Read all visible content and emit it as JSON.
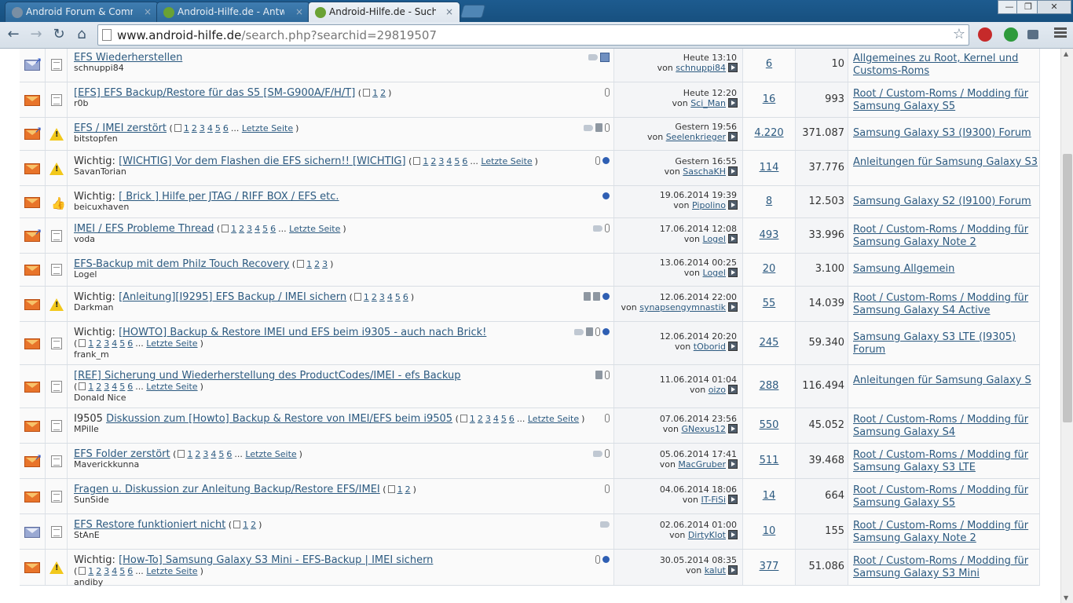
{
  "browser": {
    "tabs": [
      {
        "title": "Android Forum & Comm",
        "active": false
      },
      {
        "title": "Android-Hilfe.de - Antwo",
        "active": false
      },
      {
        "title": "Android-Hilfe.de - Sucher",
        "active": true
      }
    ],
    "close_glyph": "×",
    "url_host": "www.android-hilfe.de",
    "url_path": "/search.php?searchid=29819507",
    "window_controls": {
      "minimize": "—",
      "maximize": "❐",
      "close": "✕"
    }
  },
  "labels": {
    "prefix_important": "Wichtig:",
    "by": "von",
    "last_page": "Letzte Seite",
    "ellipsis": "..."
  },
  "threads": [
    {
      "status": "read-arrow",
      "icon": "doc",
      "prefix": "",
      "title": "EFS Wiederherstellen",
      "pages": [],
      "last_page": false,
      "author": "schnuppi84",
      "tags": [
        "tag",
        "check"
      ],
      "date": "Heute 13:10",
      "last_by": "schnuppi84",
      "replies": "6",
      "views": "10",
      "forum": "Allgemeines zu Root, Kernel und Customs-Roms"
    },
    {
      "status": "unread",
      "icon": "doc",
      "prefix": "",
      "title": "[EFS] EFS Backup/Restore für das S5 [SM-G900A/F/H/T]",
      "pages": [
        "1",
        "2"
      ],
      "last_page": false,
      "author": "r0b",
      "tags": [
        "clip"
      ],
      "date": "Heute 12:20",
      "last_by": "Sci_Man",
      "replies": "16",
      "views": "993",
      "forum": "Root / Custom-Roms / Modding für Samsung Galaxy S5"
    },
    {
      "status": "unread-arrow",
      "icon": "warn",
      "prefix": "",
      "title": "EFS / IMEI zerstört",
      "pages": [
        "1",
        "2",
        "3",
        "4",
        "5",
        "6"
      ],
      "last_page": true,
      "author": "bitstopfen",
      "tags": [
        "tag",
        "trash",
        "clip"
      ],
      "date": "Gestern 19:56",
      "last_by": "Seelenkrieger",
      "replies": "4.220",
      "views": "371.087",
      "forum": "Samsung Galaxy S3 (I9300) Forum"
    },
    {
      "status": "unread",
      "icon": "warn",
      "prefix": "Wichtig:",
      "title": "[WICHTIG] Vor dem Flashen die EFS sichern!! [WICHTIG]",
      "pages": [
        "1",
        "2",
        "3",
        "4",
        "5",
        "6"
      ],
      "last_page": true,
      "author": "SavanTorian",
      "tags": [
        "clip",
        "pin"
      ],
      "date": "Gestern 16:55",
      "last_by": "SaschaKH",
      "replies": "114",
      "views": "37.776",
      "forum": "Anleitungen für Samsung Galaxy S3"
    },
    {
      "status": "unread",
      "icon": "thumb",
      "prefix": "Wichtig:",
      "title": "[ Brick ] Hilfe per JTAG / RIFF BOX / EFS etc.",
      "pages": [],
      "last_page": false,
      "author": "beicuxhaven",
      "tags": [
        "pin"
      ],
      "date": "19.06.2014 19:39",
      "last_by": "Pipolino",
      "replies": "8",
      "views": "12.503",
      "forum": "Samsung Galaxy S2 (I9100) Forum"
    },
    {
      "status": "unread-arrow",
      "icon": "doc",
      "prefix": "",
      "title": "IMEI / EFS Probleme Thread",
      "pages": [
        "1",
        "2",
        "3",
        "4",
        "5",
        "6"
      ],
      "last_page": true,
      "author": "voda",
      "tags": [
        "tag",
        "clip"
      ],
      "date": "17.06.2014 12:08",
      "last_by": "Logel",
      "replies": "493",
      "views": "33.996",
      "forum": "Root / Custom-Roms / Modding für Samsung Galaxy Note 2"
    },
    {
      "status": "unread",
      "icon": "doc",
      "prefix": "",
      "title": "EFS-Backup mit dem Philz Touch Recovery",
      "pages": [
        "1",
        "2",
        "3"
      ],
      "last_page": false,
      "author": "Logel",
      "tags": [],
      "date": "13.06.2014 00:25",
      "last_by": "Logel",
      "replies": "20",
      "views": "3.100",
      "forum": "Samsung Allgemein"
    },
    {
      "status": "unread",
      "icon": "warn",
      "prefix": "Wichtig:",
      "title": "[Anleitung][I9295] EFS Backup / IMEI sichern",
      "pages": [
        "1",
        "2",
        "3",
        "4",
        "5",
        "6"
      ],
      "last_page": false,
      "author": "Darkman",
      "tags": [
        "trash",
        "trash",
        "pin"
      ],
      "date": "12.06.2014 22:00",
      "last_by": "synapsengymnastik",
      "replies": "55",
      "views": "14.039",
      "forum": "Root / Custom-Roms / Modding für Samsung Galaxy S4 Active"
    },
    {
      "status": "unread",
      "icon": "doc",
      "prefix": "Wichtig:",
      "title": "[HOWTO] Backup & Restore IMEI und EFS beim i9305 - auch nach Brick!",
      "pages": [
        "1",
        "2",
        "3",
        "4",
        "5",
        "6"
      ],
      "last_page": true,
      "pages_newline": true,
      "author": "frank_m",
      "tags": [
        "tag",
        "trash",
        "clip",
        "pin"
      ],
      "date": "12.06.2014 20:20",
      "last_by": "tOborid",
      "replies": "245",
      "views": "59.340",
      "forum": "Samsung Galaxy S3 LTE (I9305) Forum"
    },
    {
      "status": "unread",
      "icon": "doc",
      "prefix": "",
      "title": "[REF] Sicherung und Wiederherstellung des ProductCodes/IMEI - efs Backup",
      "pages": [
        "1",
        "2",
        "3",
        "4",
        "5",
        "6"
      ],
      "last_page": true,
      "pages_newline": true,
      "author": "Donald Nice",
      "tags": [
        "trash",
        "clip"
      ],
      "date": "11.06.2014 01:04",
      "last_by": "oizo",
      "replies": "288",
      "views": "116.494",
      "forum": "Anleitungen für Samsung Galaxy S"
    },
    {
      "status": "unread",
      "icon": "doc",
      "prefix": "I9505",
      "title": "Diskussion zum [Howto] Backup & Restore von IMEI/EFS beim i9505",
      "pages": [
        "1",
        "2",
        "3",
        "4",
        "5",
        "6"
      ],
      "last_page": true,
      "author": "MPille",
      "tags": [
        "clip"
      ],
      "date": "07.06.2014 23:56",
      "last_by": "GNexus12",
      "replies": "550",
      "views": "45.052",
      "forum": "Root / Custom-Roms / Modding für Samsung Galaxy S4"
    },
    {
      "status": "unread-arrow",
      "icon": "doc",
      "prefix": "",
      "title": "EFS Folder zerstört",
      "pages": [
        "1",
        "2",
        "3",
        "4",
        "5",
        "6"
      ],
      "last_page": true,
      "author": "Maverickkunna",
      "tags": [
        "tag",
        "clip"
      ],
      "date": "05.06.2014 17:41",
      "last_by": "MacGruber",
      "replies": "511",
      "views": "39.468",
      "forum": "Root / Custom-Roms / Modding für Samsung Galaxy S3 LTE"
    },
    {
      "status": "unread",
      "icon": "doc",
      "prefix": "",
      "title": "Fragen u. Diskussion zur Anleitung Backup/Restore EFS/IMEI",
      "pages": [
        "1",
        "2"
      ],
      "last_page": false,
      "author": "SunSide",
      "tags": [
        "clip"
      ],
      "date": "04.06.2014 18:06",
      "last_by": "IT-FiSi",
      "replies": "14",
      "views": "664",
      "forum": "Root / Custom-Roms / Modding für Samsung Galaxy S5"
    },
    {
      "status": "read",
      "icon": "doc",
      "prefix": "",
      "title": "EFS Restore funktioniert nicht",
      "pages": [
        "1",
        "2"
      ],
      "last_page": false,
      "author": "StAnE",
      "tags": [
        "tag"
      ],
      "date": "02.06.2014 01:00",
      "last_by": "DirtyKlot",
      "replies": "10",
      "views": "155",
      "forum": "Root / Custom-Roms / Modding für Samsung Galaxy Note 2"
    },
    {
      "status": "unread",
      "icon": "warn",
      "prefix": "Wichtig:",
      "title": "[How-To] Samsung Galaxy S3 Mini - EFS-Backup | IMEI sichern",
      "pages": [
        "1",
        "2",
        "3",
        "4",
        "5",
        "6"
      ],
      "last_page": true,
      "pages_newline": true,
      "author": "andiby",
      "tags": [
        "clip",
        "pin"
      ],
      "date": "30.05.2014 08:35",
      "last_by": "kalut",
      "replies": "377",
      "views": "51.086",
      "forum": "Root / Custom-Roms / Modding für Samsung Galaxy S3 Mini"
    }
  ]
}
